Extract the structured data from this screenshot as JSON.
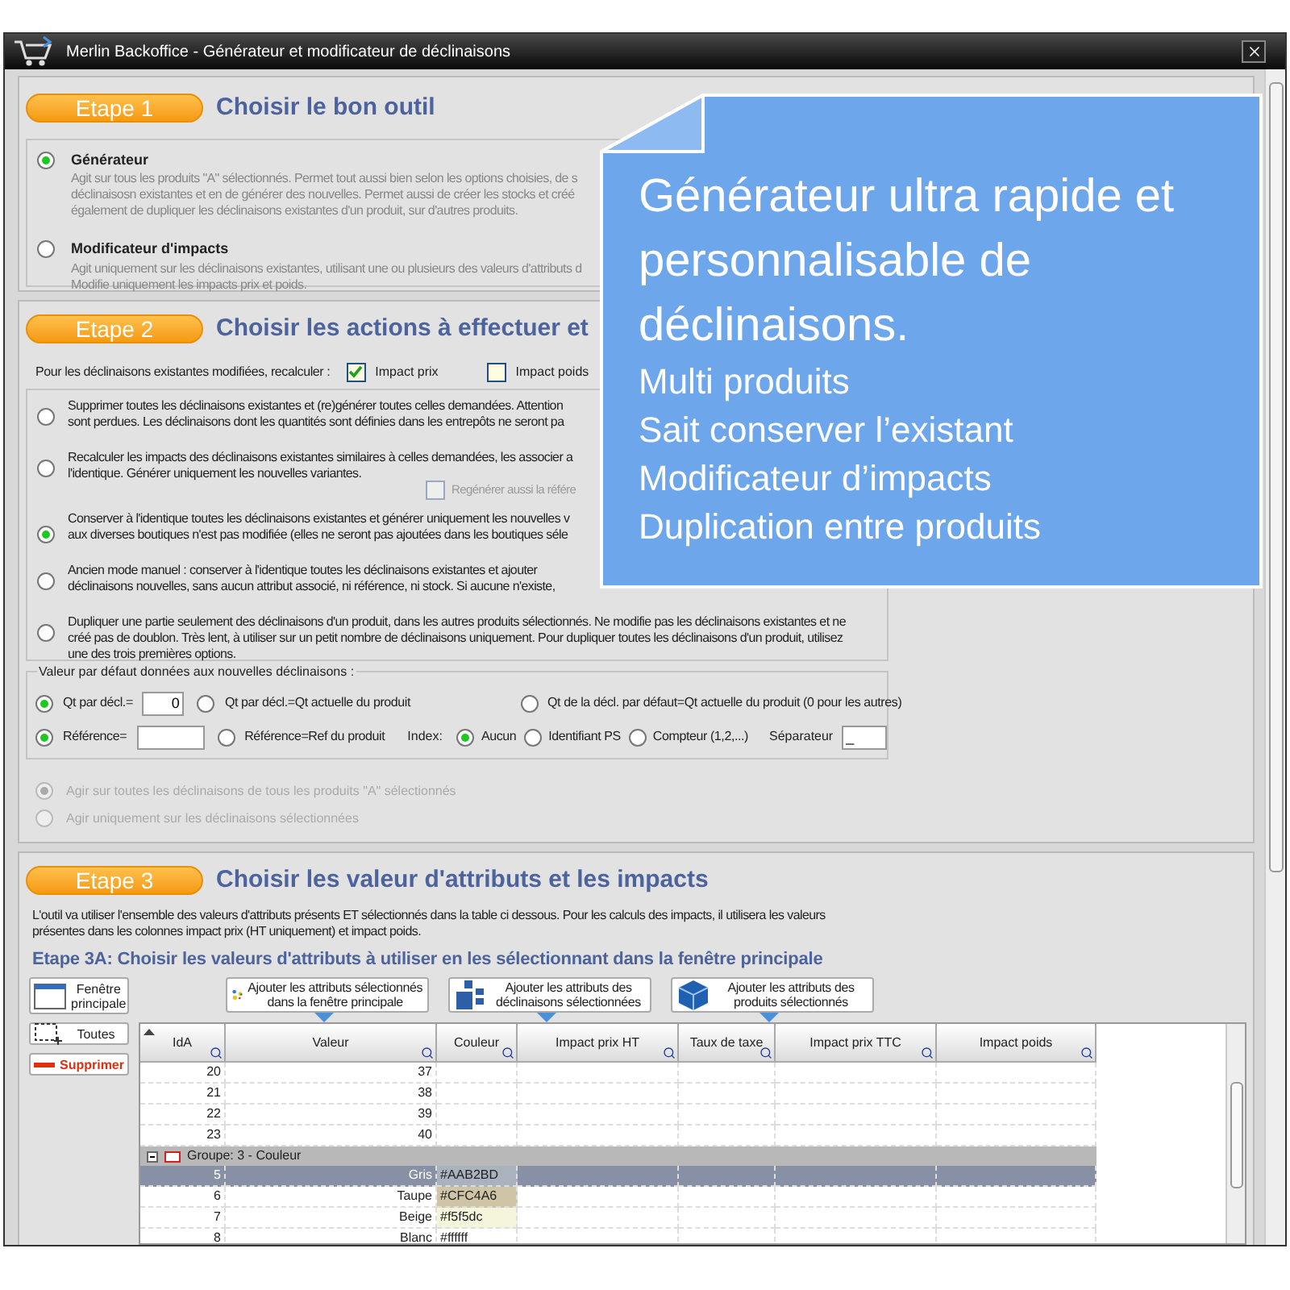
{
  "window": {
    "title": "Merlin Backoffice - Générateur et modificateur de déclinaisons"
  },
  "callout": {
    "headline": [
      "Générateur ultra rapide et",
      "personnalisable de",
      "déclinaisons."
    ],
    "features": [
      "Multi produits",
      "Sait conserver l’existant",
      "Modificateur d’impacts",
      "Duplication entre produits"
    ]
  },
  "step1": {
    "badge": "Etape 1",
    "title": "Choisir le bon outil",
    "tools": [
      {
        "label": "Générateur",
        "selected": true,
        "lines": [
          "Agit sur tous les produits \"A\" sélectionnés. Permet tout aussi bien selon les options choisies, de s",
          "déclinaisosn existantes et en de générer des nouvelles. Permet aussi de créer les stocks et créé",
          "également de dupliquer les déclinaisons existantes d'un produit, sur d'autres produits."
        ]
      },
      {
        "label": "Modificateur d'impacts",
        "selected": false,
        "lines": [
          "Agit uniquement sur les déclinaisons existantes, utilisant une ou plusieurs des valeurs d'attributs d",
          "Modifie uniquement les impacts prix et poids."
        ]
      }
    ]
  },
  "step2": {
    "badge": "Etape 2",
    "title": "Choisir les actions à effectuer et",
    "recalc_label": "Pour les déclinaisons existantes modifiées, recalculer :",
    "recalc_checks": [
      {
        "label": "Impact prix",
        "checked": true
      },
      {
        "label": "Impact poids",
        "checked": false
      }
    ],
    "modes": [
      {
        "selected": false,
        "lines": [
          "Supprimer toutes les déclinaisons existantes et (re)générer toutes celles demandées. Attention",
          "sont perdues. Les déclinaisons dont les quantités sont définies dans les entrepôts ne seront pa"
        ]
      },
      {
        "selected": false,
        "lines": [
          "Recalculer les impacts des déclinaisons existantes similaires à celles demandées, les associer a",
          "l'identique. Générer uniquement les nouvelles variantes."
        ],
        "extra_check": {
          "label": "Regénérer aussi la référe",
          "checked": false
        }
      },
      {
        "selected": true,
        "lines": [
          "Conserver à l'identique toutes les déclinaisons existantes et générer uniquement les nouvelles v",
          "aux diverses boutiques n'est pas modifiée (elles ne seront pas ajoutées dans les boutiques séle"
        ]
      },
      {
        "selected": false,
        "lines": [
          "Ancien mode manuel : conserver à l'identique toutes les déclinaisons existantes et ajouter",
          "déclinaisons nouvelles, sans aucun attribut associé, ni référence, ni stock. Si aucune n'existe,"
        ]
      },
      {
        "selected": false,
        "lines": [
          "Dupliquer une partie seulement des déclinaisons d'un produit, dans les autres produits sélectionnés. Ne modifie pas les déclinaisons existantes et ne",
          "créé pas de doublon. Très lent, à utiliser sur un petit nombre de déclinaisons uniquement. Pour dupliquer toutes les déclinaisons d'un produit, utilisez",
          "une des trois premières options."
        ]
      }
    ],
    "defaults": {
      "legend": "Valeur par défaut données aux nouvelles déclinaisons :",
      "qty_options": [
        {
          "kind": "input",
          "label": "Qt par décl.=",
          "value": "0",
          "selected": true
        },
        {
          "kind": "plain",
          "label": "Qt par décl.=Qt actuelle du produit",
          "selected": false
        },
        {
          "kind": "plain",
          "label": "Qt de la décl. par défaut=Qt actuelle du produit (0 pour les autres)",
          "selected": false
        }
      ],
      "ref_options": [
        {
          "kind": "input",
          "label": "Référence=",
          "selected": true
        },
        {
          "kind": "plain",
          "label": "Référence=Ref du produit",
          "selected": false
        }
      ],
      "index_label": "Index:",
      "index_options": [
        {
          "label": "Aucun",
          "selected": true
        },
        {
          "label": "Identifiant PS",
          "selected": false
        },
        {
          "label": "Compteur (1,2,...)",
          "selected": false
        }
      ],
      "separator_label": "Séparateur",
      "separator_value": "_"
    },
    "scope": [
      {
        "label": "Agir sur toutes les déclinaisons de tous les produits \"A\" sélectionnés",
        "selected": true,
        "disabled": true
      },
      {
        "label": "Agir uniquement sur les déclinaisons sélectionnées",
        "selected": false,
        "disabled": true
      }
    ]
  },
  "step3": {
    "badge": "Etape 3",
    "title": "Choisir les valeur d'attributs et les impacts",
    "description": [
      "L'outil va utiliser l'ensemble des valeurs d'attributs présents ET sélectionnés dans la table ci dessous. Pour les calculs des impacts, il utilisera les valeurs",
      "présentes dans les colonnes impact prix (HT uniquement) et impact poids."
    ],
    "subtitle": "Etape 3A: Choisir les valeurs d'attributs à utiliser en les sélectionnant dans la fenêtre principale",
    "side_buttons": [
      {
        "kind": "window",
        "lines": [
          "Fenêtre",
          "principale"
        ]
      },
      {
        "kind": "select",
        "lines": [
          "Toutes"
        ]
      },
      {
        "kind": "delete",
        "lines": [
          "Supprimer"
        ]
      }
    ],
    "add_buttons": [
      {
        "kind": "dots",
        "lines": [
          "Ajouter les attributs sélectionnés",
          "dans la fenêtre principale"
        ]
      },
      {
        "kind": "grid",
        "lines": [
          "Ajouter les attributs des",
          "déclinaisons sélectionnées"
        ]
      },
      {
        "kind": "cube",
        "lines": [
          "Ajouter les attributs des",
          "produits sélectionnés"
        ]
      }
    ],
    "table": {
      "columns": [
        "IdA",
        "Valeur",
        "Couleur",
        "Impact prix HT",
        "Taux de taxe",
        "Impact prix TTC",
        "Impact poids"
      ],
      "rows": [
        {
          "kind": "row",
          "id": "20",
          "value": "37",
          "selected": false
        },
        {
          "kind": "row",
          "id": "21",
          "value": "38",
          "selected": false
        },
        {
          "kind": "row",
          "id": "22",
          "value": "39",
          "selected": false
        },
        {
          "kind": "row",
          "id": "23",
          "value": "40",
          "selected": false
        },
        {
          "kind": "group",
          "label": "Groupe: 3 - Couleur",
          "expanded": true
        },
        {
          "kind": "row",
          "id": "5",
          "value": "Gris",
          "color_text": "#AAB2BD",
          "color": "#aab2bd",
          "selected": true
        },
        {
          "kind": "row",
          "id": "6",
          "value": "Taupe",
          "color_text": "#CFC4A6",
          "color": "#cfc4a6",
          "selected": false
        },
        {
          "kind": "row",
          "id": "7",
          "value": "Beige",
          "color_text": "#f5f5dc",
          "color": "#f5f5dc",
          "selected": false
        },
        {
          "kind": "row",
          "id": "8",
          "value": "Blanc",
          "color_text": "#ffffff",
          "color": "#ffffff",
          "selected": false
        }
      ]
    }
  }
}
